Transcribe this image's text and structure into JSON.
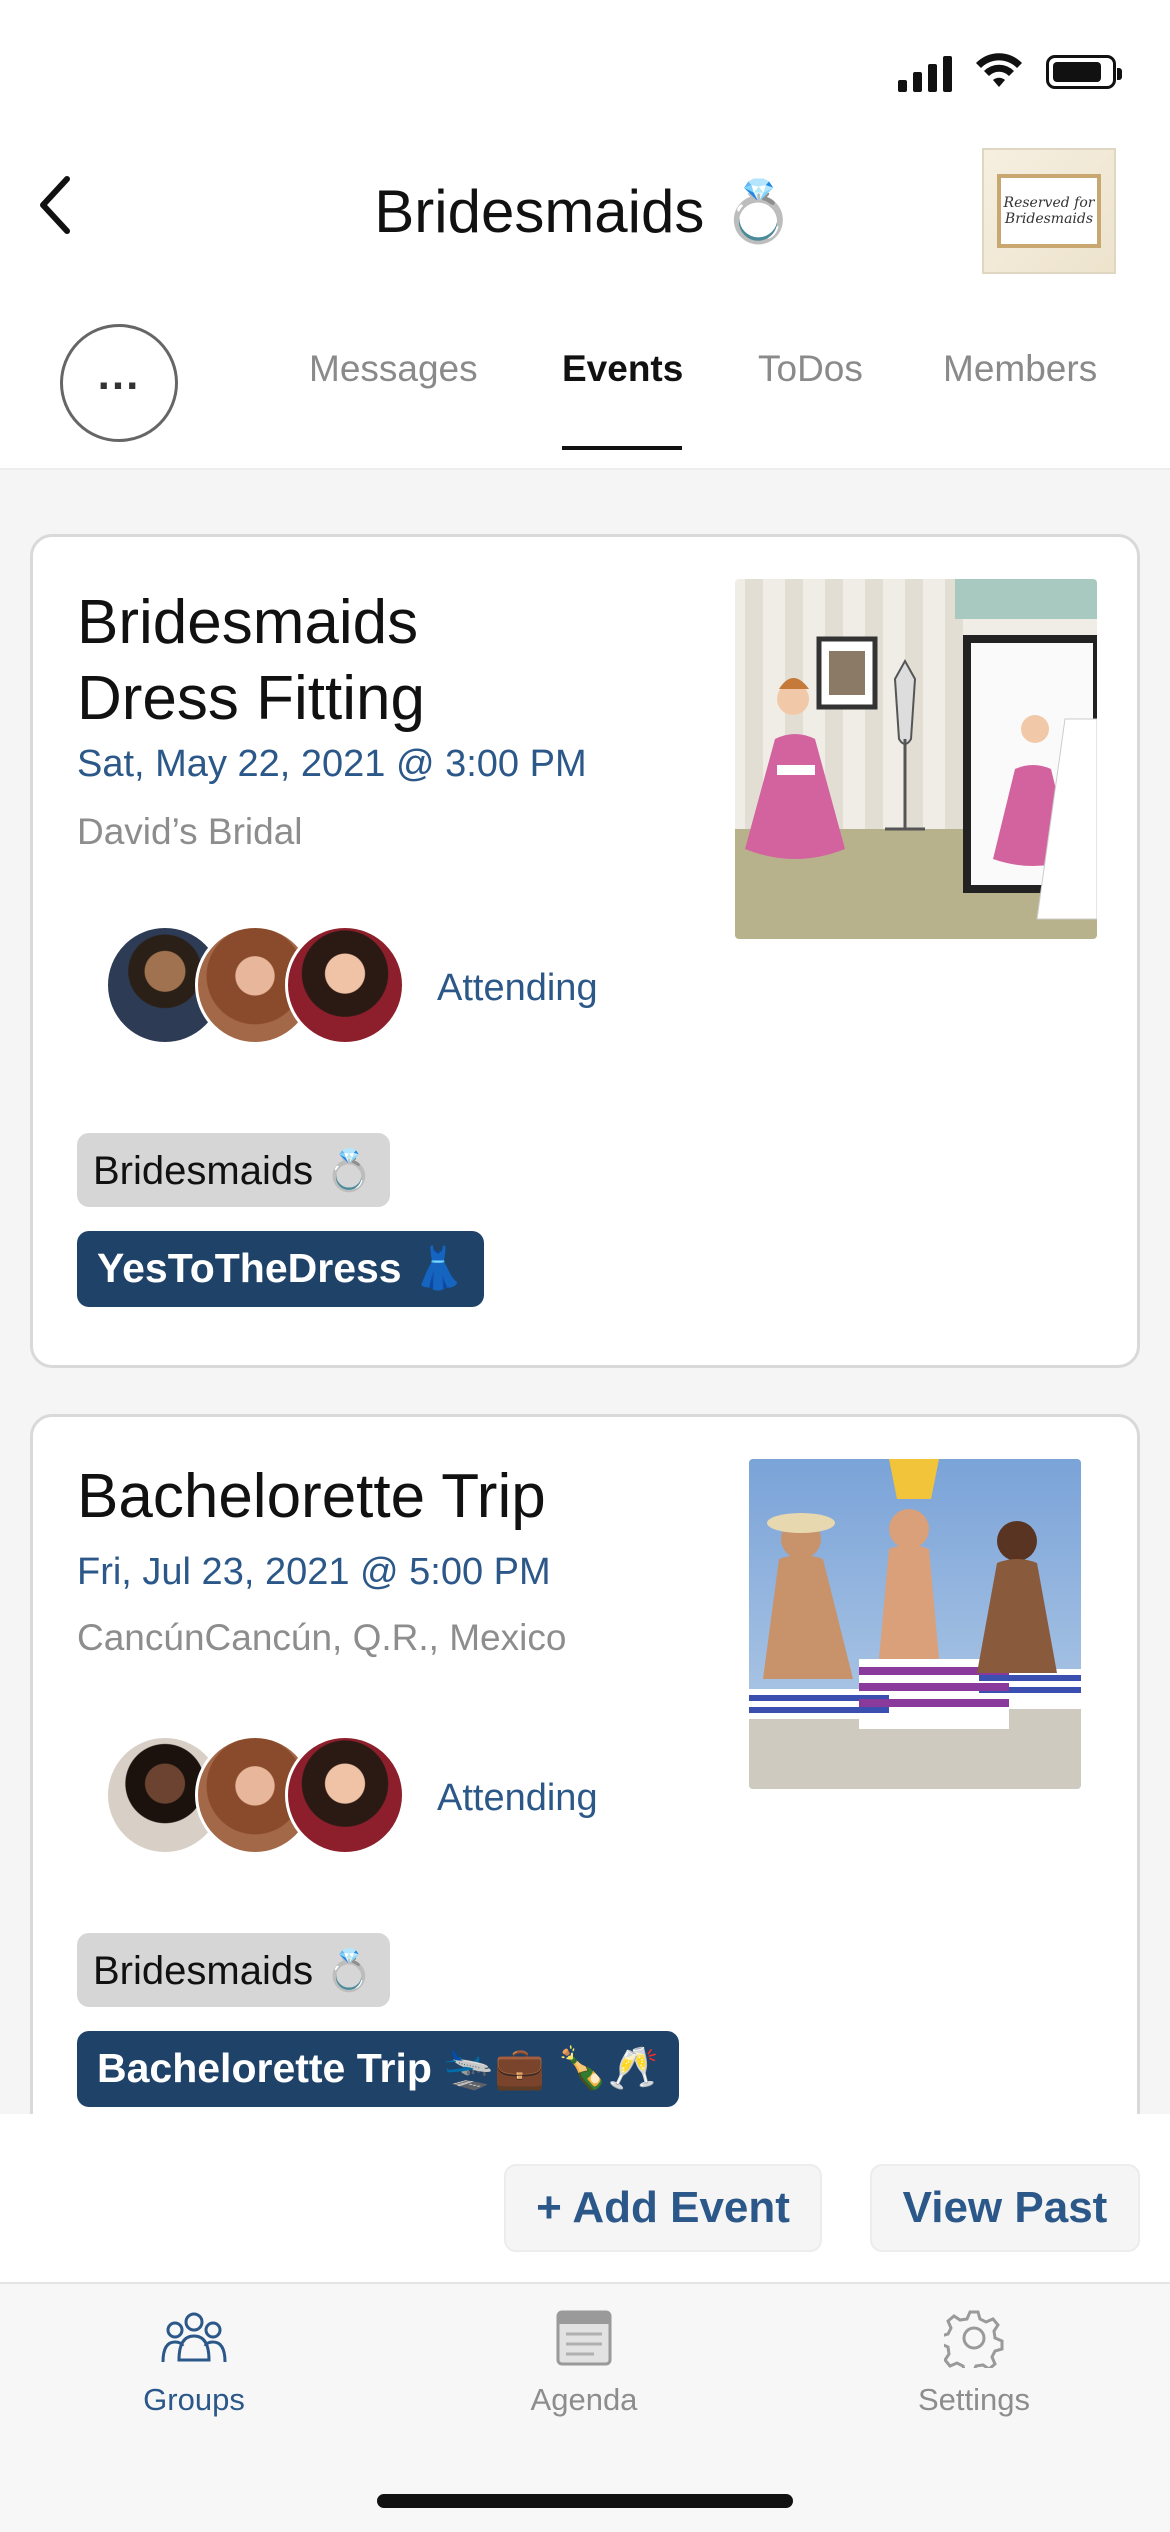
{
  "header": {
    "title": "Bridesmaids 💍",
    "group_image_text": "Reserved for Bridesmaids"
  },
  "tabs": {
    "more_label": "...",
    "items": [
      {
        "label": "Messages",
        "active": false
      },
      {
        "label": "Events",
        "active": true
      },
      {
        "label": "ToDos",
        "active": false
      },
      {
        "label": "Members",
        "active": false
      }
    ]
  },
  "events": [
    {
      "title_line1": "Bridesmaids",
      "title_line2": "Dress Fitting",
      "date": "Sat, May 22, 2021 @ 3:00 PM",
      "location": "David’s Bridal",
      "rsvp": "Attending",
      "tags": [
        "Bridesmaids 💍",
        "YesToTheDress 👗"
      ]
    },
    {
      "title_line1": "Bachelorette Trip",
      "date": "Fri, Jul 23, 2021 @ 5:00 PM",
      "location": "CancúnCancún, Q.R., Mexico",
      "rsvp": "Attending",
      "tags": [
        "Bridesmaids 💍",
        "Bachelorette Trip 🛬💼 🍾🥂"
      ]
    }
  ],
  "actions": {
    "add_event": "+ Add Event",
    "view_past": "View Past"
  },
  "bottom_nav": [
    {
      "label": "Groups",
      "icon": "groups-icon",
      "active": true
    },
    {
      "label": "Agenda",
      "icon": "agenda-icon",
      "active": false
    },
    {
      "label": "Settings",
      "icon": "gear-icon",
      "active": false
    }
  ],
  "colors": {
    "accent": "#2b5888",
    "tag_navy": "#1f4268",
    "tag_gray": "#d6d6d6"
  }
}
